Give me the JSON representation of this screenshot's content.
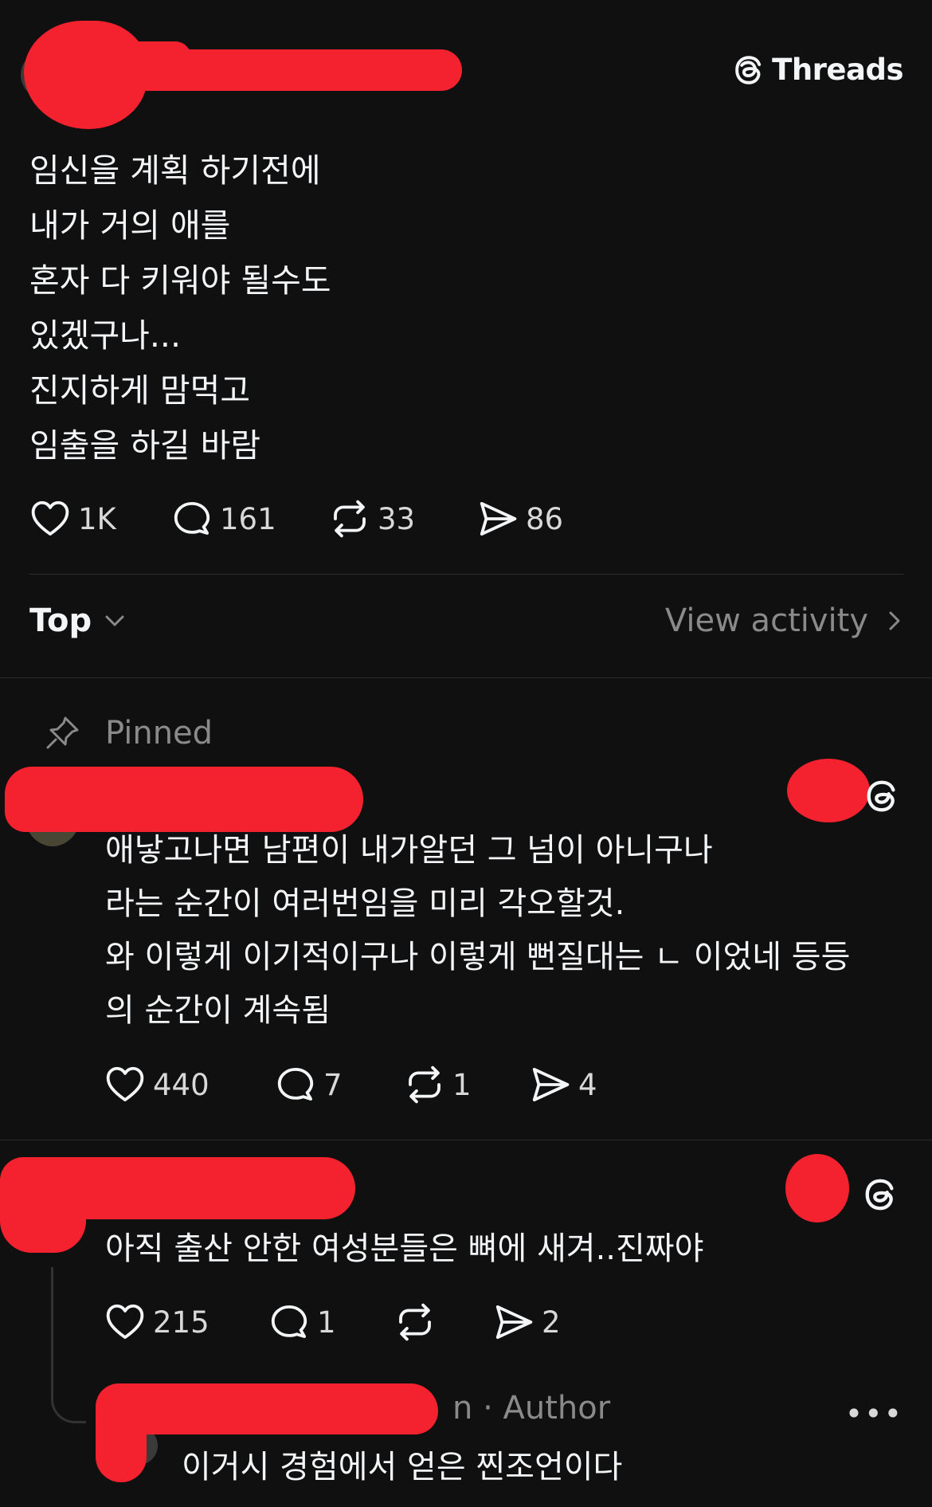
{
  "header": {
    "brand_label": "Threads",
    "brand_icon": "threads-logo-icon"
  },
  "post": {
    "lines": [
      "임신을 계획 하기전에",
      "내가 거의 애를",
      "혼자 다 키워야 될수도",
      "있겠구나...",
      "진지하게 맘먹고",
      "임출을 하길 바람"
    ],
    "likes": "1K",
    "comments": "161",
    "reposts": "33",
    "shares": "86"
  },
  "sort": {
    "label": "Top",
    "view_activity": "View activity"
  },
  "pinned_label": "Pinned",
  "comment1": {
    "lines": [
      "애낳고나면 남편이 내가알던 그 넘이 아니구나",
      "라는 순간이 여러번임을 미리 각오할것.",
      "와 이렇게 이기적이구나 이렇게 뻔질대는 ㄴ 이었네 등등",
      "의 순간이 계속됨"
    ],
    "likes": "440",
    "comments": "7",
    "reposts": "1",
    "shares": "4"
  },
  "comment2": {
    "text": "아직 출산 안한 여성분들은 뼈에 새겨..진짜야",
    "likes": "215",
    "comments": "1",
    "shares": "2"
  },
  "reply": {
    "author_suffix": "n · Author",
    "more": "•••",
    "text": "이거시 경험에서 얻은 찐조언이다"
  },
  "colors": {
    "background": "#101010",
    "text": "#f3f5f7",
    "muted": "#8a8a8a",
    "redaction": "#f4212e"
  }
}
